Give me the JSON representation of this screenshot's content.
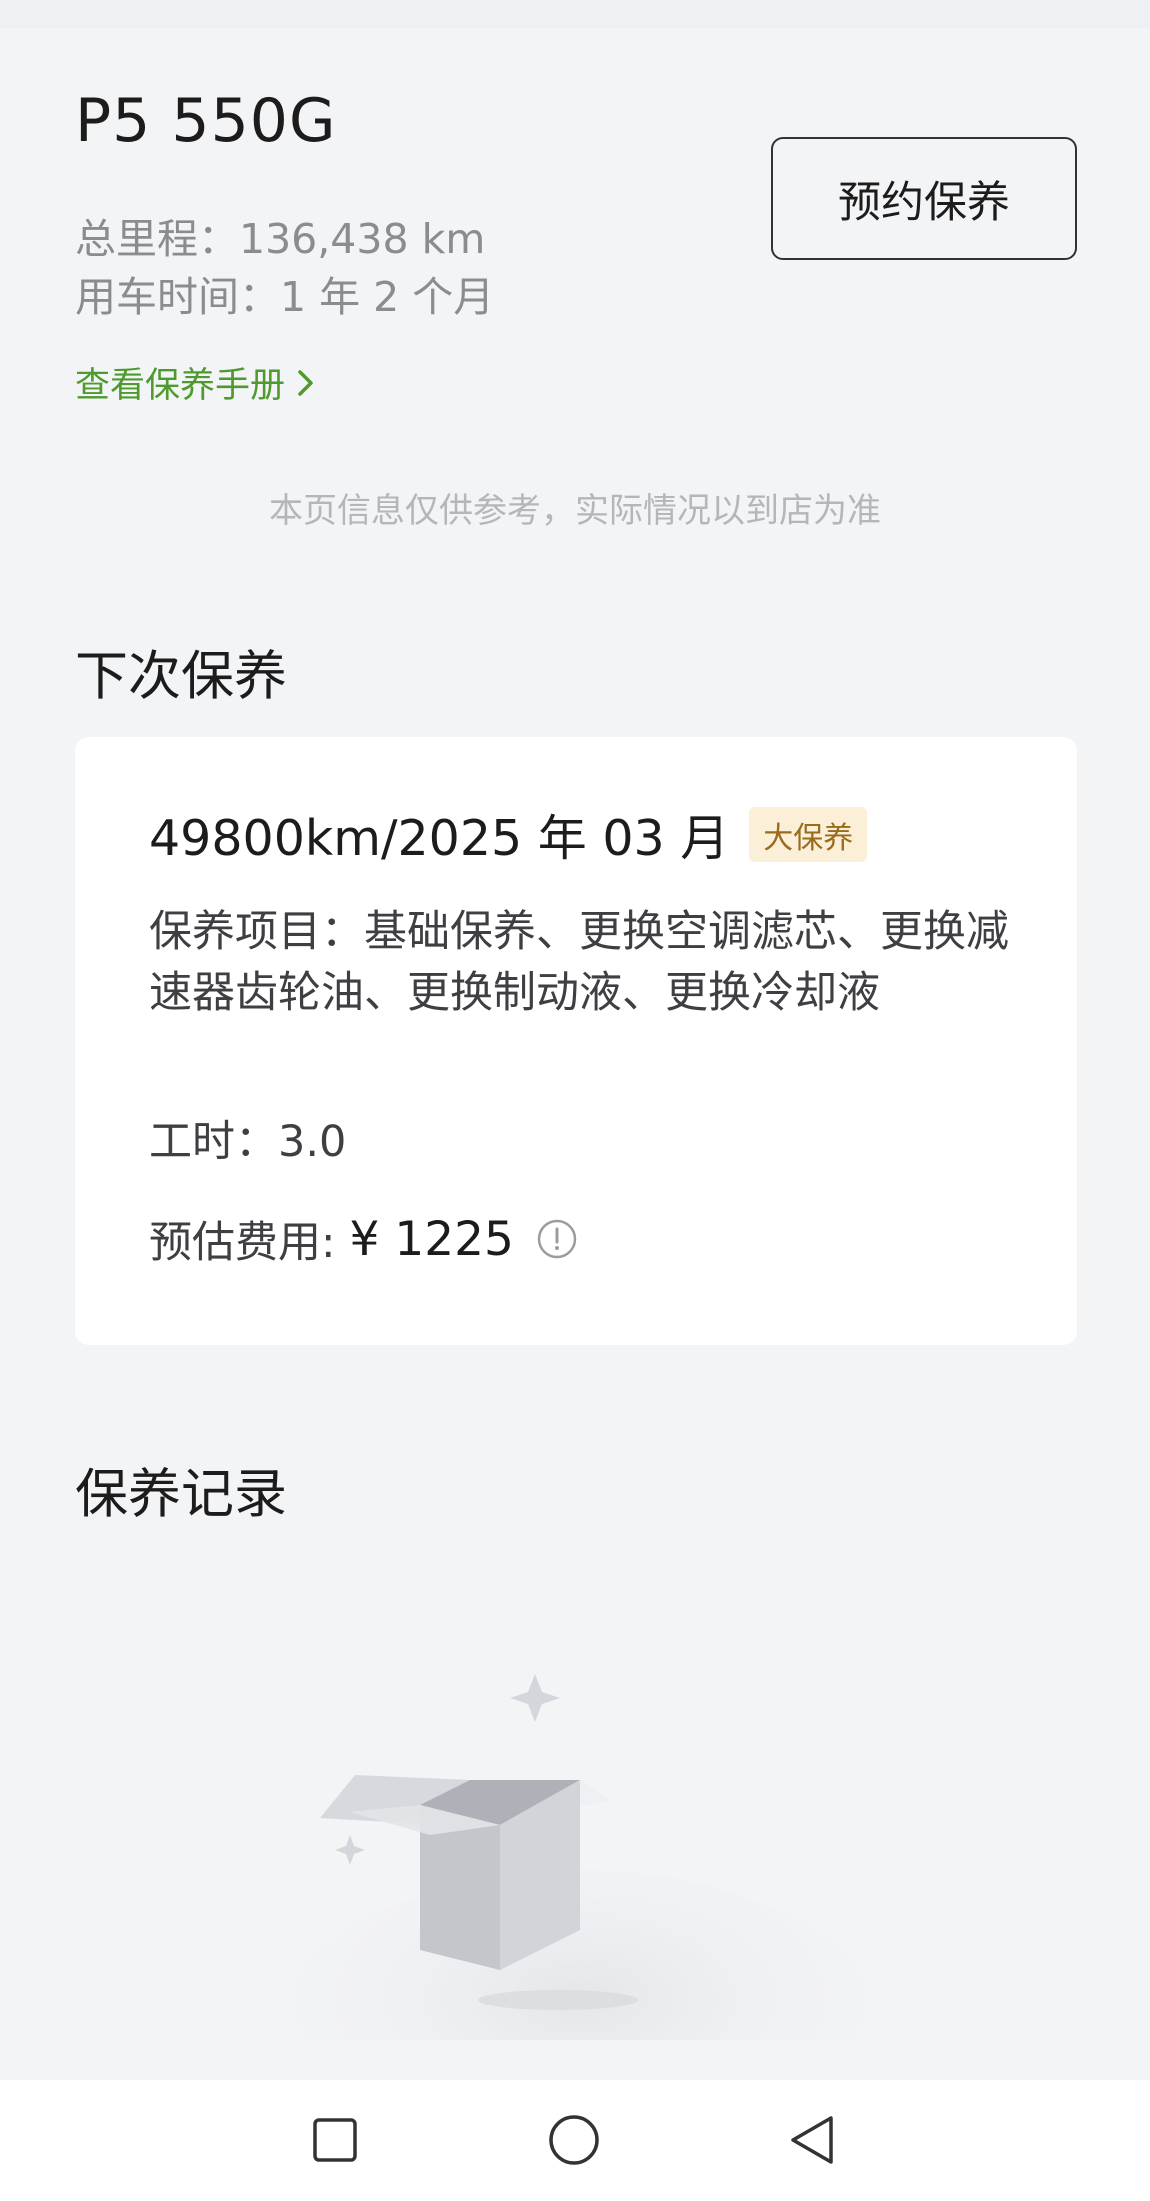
{
  "vehicle": {
    "model": "P5 550G",
    "mileage_text": "总里程：136,438 km",
    "age_text": "用车时间：1 年 2 个月",
    "manual_link": "查看保养手册"
  },
  "actions": {
    "book_label": "预约保养"
  },
  "disclaimer": "本页信息仅供参考，实际情况以到店为准",
  "next_maintenance": {
    "section_title": "下次保养",
    "date_text": "49800km/2025 年 03 月",
    "badge": "大保养",
    "items_text": "保养项目：基础保养、更换空调滤芯、更换减速器齿轮油、更换制动液、更换冷却液",
    "hours_text": "工时：3.0",
    "cost_label": "预估费用:",
    "cost_value": "¥ 1225"
  },
  "records": {
    "section_title": "保养记录"
  },
  "colors": {
    "accent_green": "#4f9a2e",
    "badge_bg": "#fbefd8",
    "badge_text": "#9a6a1d"
  },
  "icons": {
    "manual_link": "chevron-right-icon",
    "cost_info": "info-icon",
    "nav_recent": "square-icon",
    "nav_home": "circle-icon",
    "nav_back": "triangle-back-icon"
  }
}
